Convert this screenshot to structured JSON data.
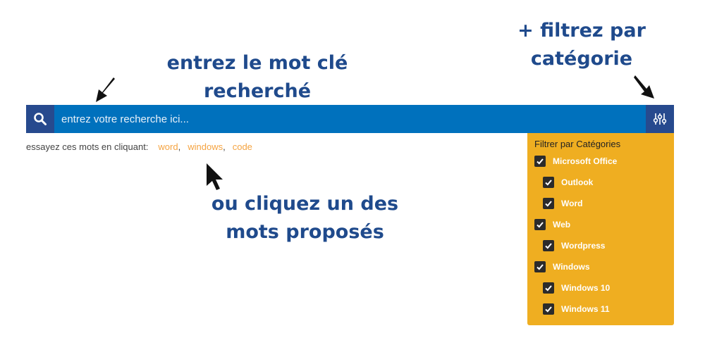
{
  "annotations": {
    "top": "entrez le mot clé recherché",
    "right_line1": "+ filtrez par",
    "right_line2": "catégorie",
    "bottom_line1": "ou cliquez un des",
    "bottom_line2": "mots proposés"
  },
  "search": {
    "placeholder": "entrez votre recherche ici...",
    "value": ""
  },
  "suggestions": {
    "label": "essayez ces mots en cliquant:",
    "items": [
      "word",
      "windows",
      "code"
    ],
    "separator": ","
  },
  "filter": {
    "title": "Filtrer par Catégories",
    "categories": [
      {
        "label": "Microsoft Office",
        "checked": true,
        "level": 0
      },
      {
        "label": "Outlook",
        "checked": true,
        "level": 1
      },
      {
        "label": "Word",
        "checked": true,
        "level": 1
      },
      {
        "label": "Web",
        "checked": true,
        "level": 0
      },
      {
        "label": "Wordpress",
        "checked": true,
        "level": 1
      },
      {
        "label": "Windows",
        "checked": true,
        "level": 0
      },
      {
        "label": "Windows 10",
        "checked": true,
        "level": 1
      },
      {
        "label": "Windows 11",
        "checked": true,
        "level": 1
      }
    ]
  },
  "colors": {
    "bar": "#0071bd",
    "buttons": "#274a8e",
    "panel": "#efae21",
    "annotation": "#1f4a8c",
    "suggestion": "#f5a442"
  },
  "icons": {
    "search": "search-icon",
    "filter": "sliders-icon",
    "checkbox": "check-icon"
  }
}
